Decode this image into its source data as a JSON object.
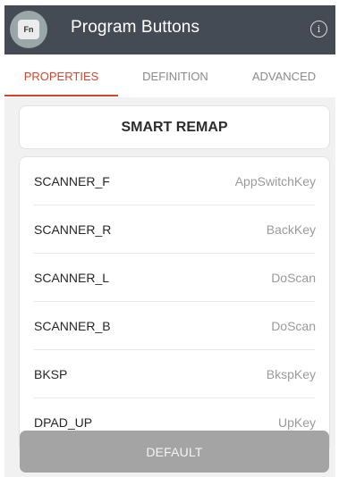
{
  "app_bar": {
    "icon_text": "Fn",
    "title": "Program Buttons",
    "info_glyph": "i"
  },
  "tabs": [
    {
      "label": "PROPERTIES",
      "active": true
    },
    {
      "label": "DEFINITION",
      "active": false
    },
    {
      "label": "ADVANCED",
      "active": false
    }
  ],
  "smart_remap": {
    "label": "SMART REMAP"
  },
  "mappings": [
    {
      "key": "SCANNER_F",
      "value": "AppSwitchKey"
    },
    {
      "key": "SCANNER_R",
      "value": "BackKey"
    },
    {
      "key": "SCANNER_L",
      "value": "DoScan"
    },
    {
      "key": "SCANNER_B",
      "value": "DoScan"
    },
    {
      "key": "BKSP",
      "value": "BkspKey"
    },
    {
      "key": "DPAD_UP",
      "value": "UpKey"
    }
  ],
  "default_button": {
    "label": "DEFAULT"
  },
  "colors": {
    "app_bar": "#444b54",
    "accent": "#d6452b",
    "default_button": "#a4a4a4"
  }
}
